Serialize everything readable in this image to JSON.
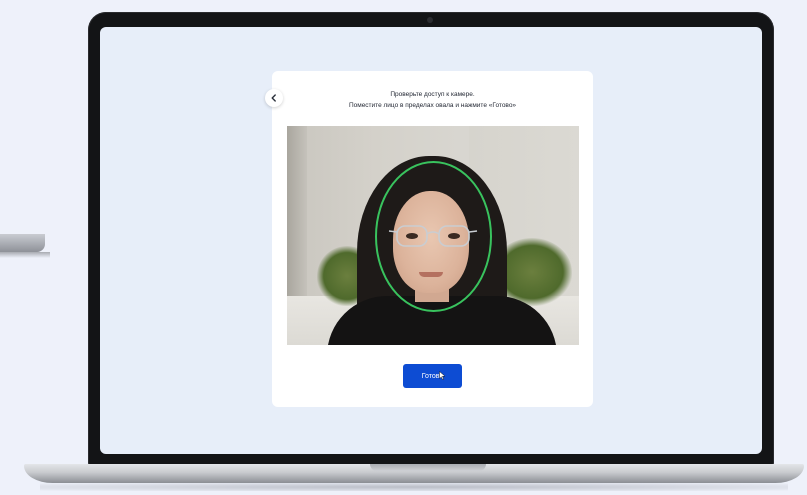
{
  "card": {
    "instruction_line1": "Проверьте доступ к камере.",
    "instruction_line2": "Поместите лицо в пределах овала и нажмите «Готово»",
    "done_label": "Готово"
  },
  "icons": {
    "back": "chevron-left-icon",
    "cursor": "mouse-pointer-icon"
  },
  "colors": {
    "primary_button": "#0d4cd3",
    "face_oval": "#39c35e",
    "screen_background": "#e7eef9"
  }
}
